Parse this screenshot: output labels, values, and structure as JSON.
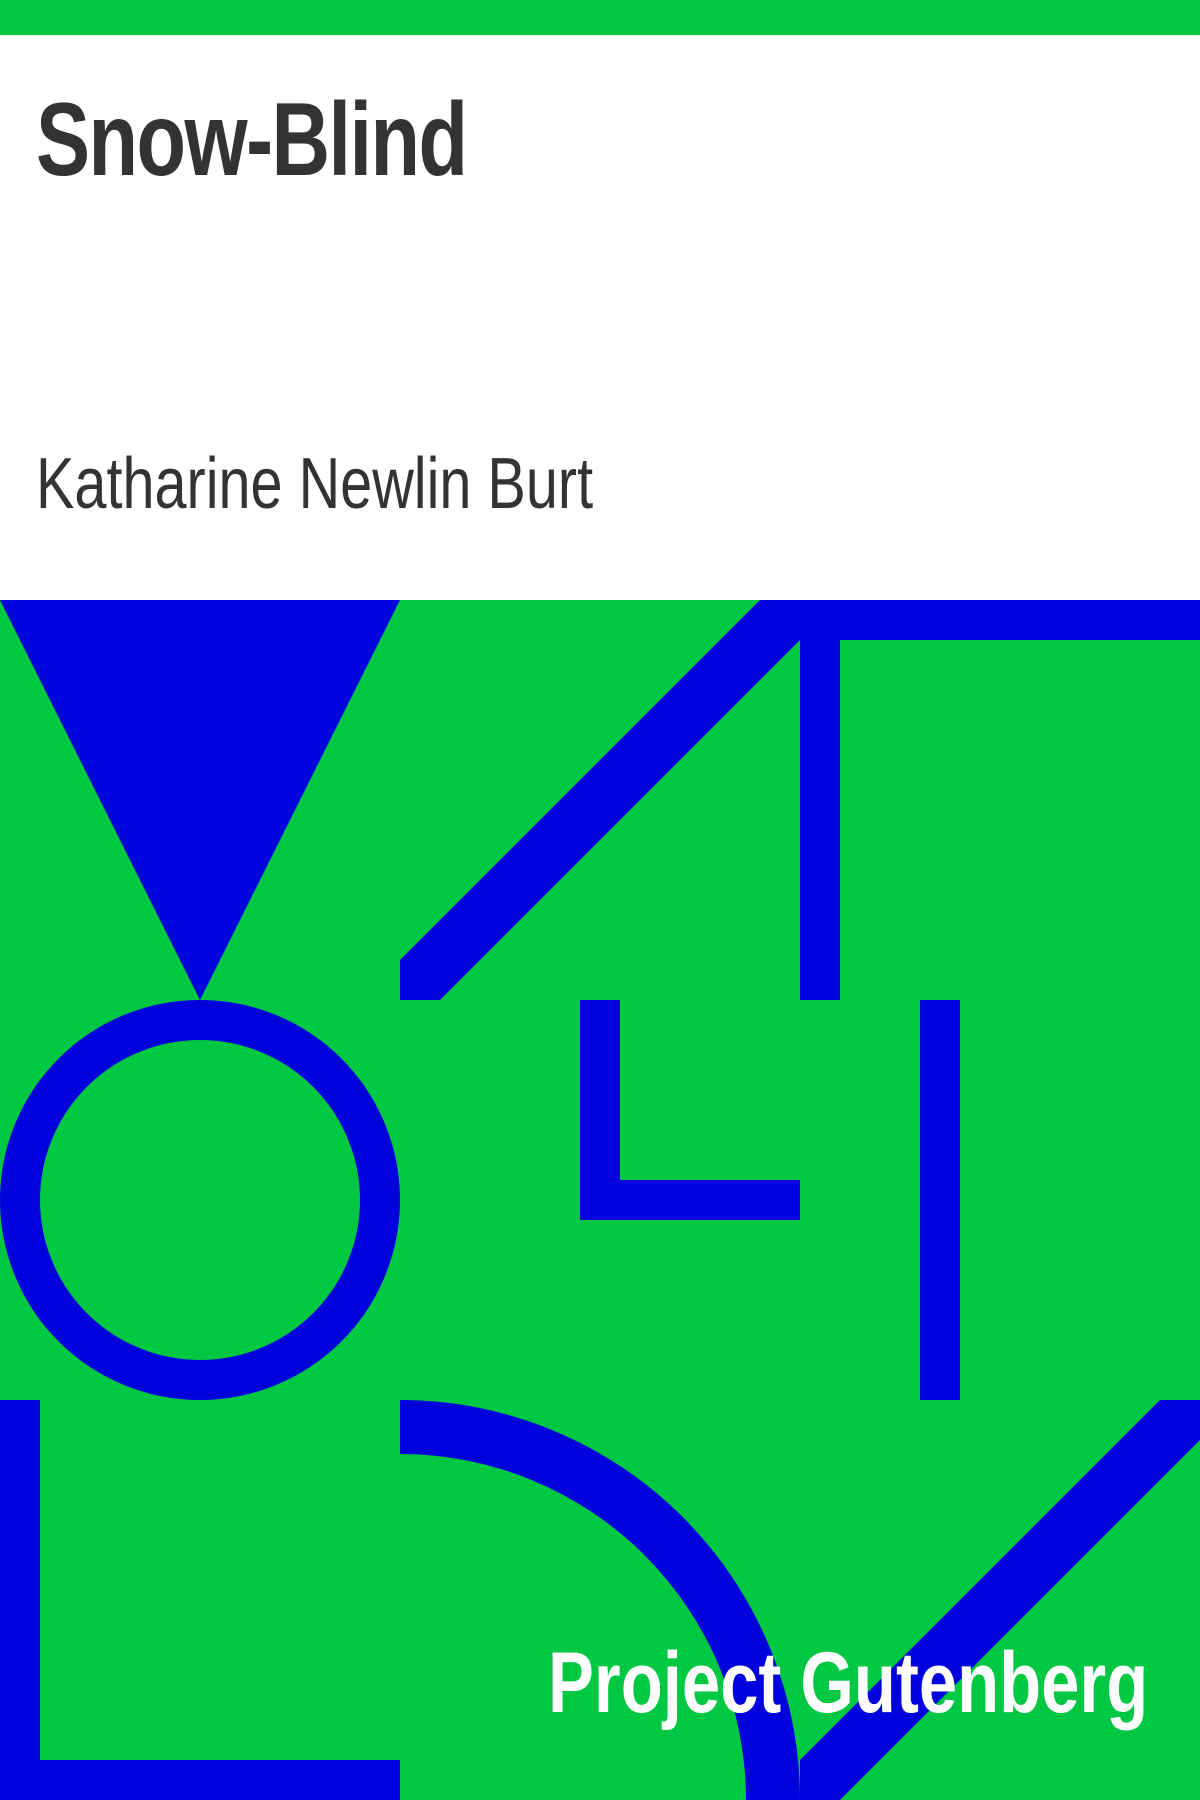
{
  "cover": {
    "title": "Snow-Blind",
    "author": "Katharine Newlin Burt",
    "publisher": "Project Gutenberg"
  },
  "colors": {
    "background": "#ffffff",
    "accent_green": "#00c842",
    "shape_blue": "#0000dc",
    "text_dark": "#333333",
    "text_light": "#ffffff"
  }
}
